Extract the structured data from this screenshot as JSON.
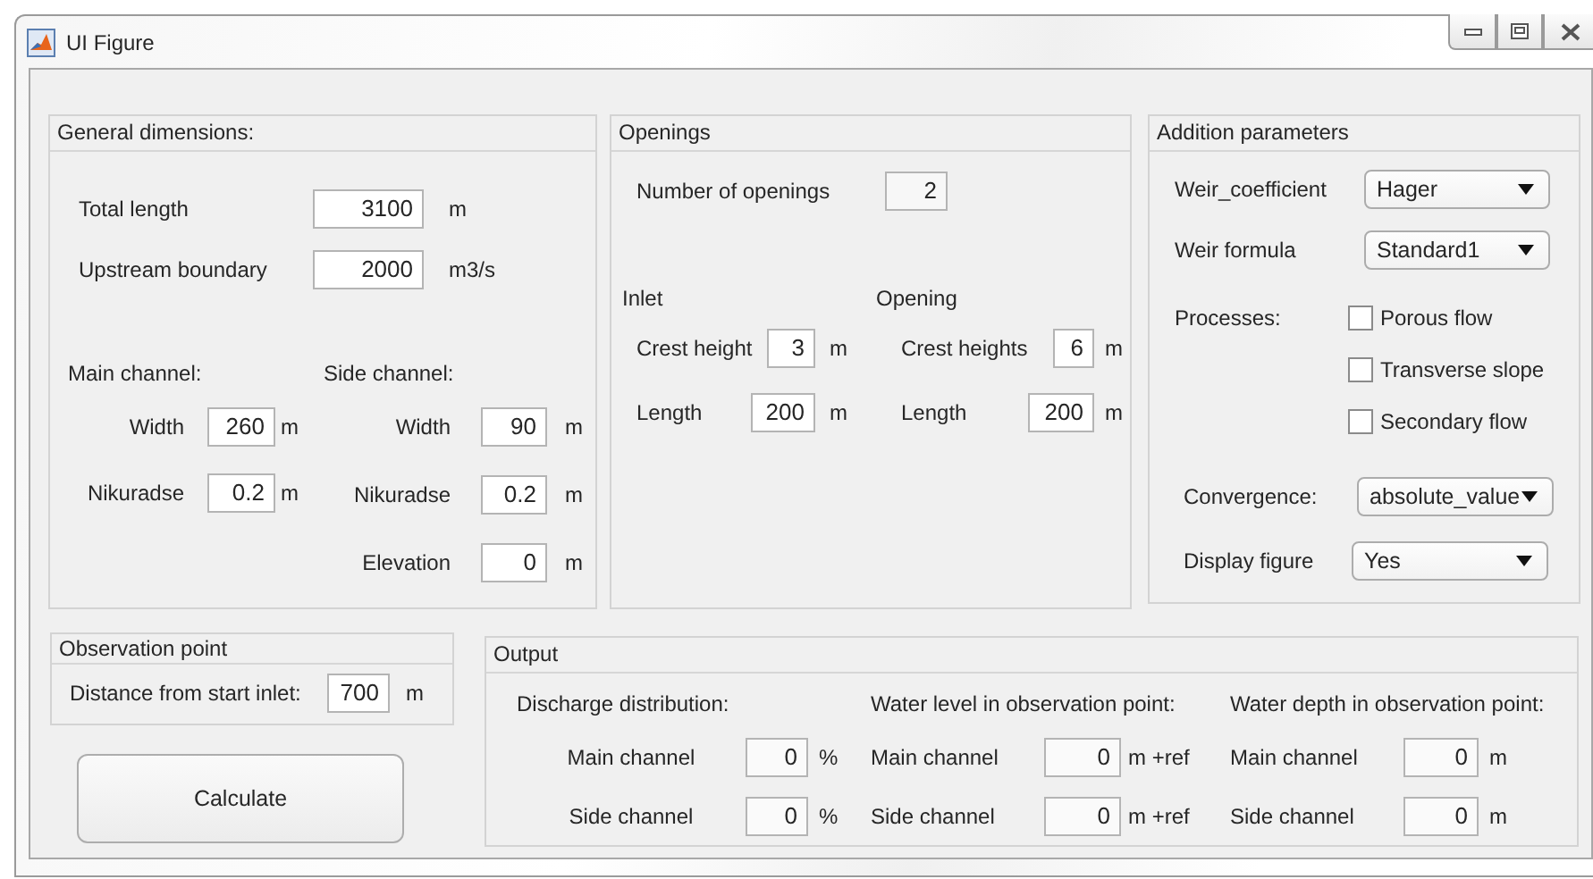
{
  "window": {
    "title": "UI Figure"
  },
  "general_dimensions": {
    "title": "General dimensions:",
    "fields": [
      {
        "label": "Total length",
        "value": "3100",
        "unit": "m"
      },
      {
        "label": "Upstream boundary",
        "value": "2000",
        "unit": "m3/s"
      }
    ],
    "main_channel": {
      "title": "Main channel:",
      "fields": [
        {
          "label": "Width",
          "value": "260",
          "unit": "m"
        },
        {
          "label": "Nikuradse",
          "value": "0.2",
          "unit": "m"
        }
      ]
    },
    "side_channel": {
      "title": "Side channel:",
      "fields": [
        {
          "label": "Width",
          "value": "90",
          "unit": "m"
        },
        {
          "label": "Nikuradse",
          "value": "0.2",
          "unit": "m"
        },
        {
          "label": "Elevation",
          "value": "0",
          "unit": "m"
        }
      ]
    }
  },
  "openings": {
    "title": "Openings",
    "number": {
      "label": "Number of openings",
      "value": "2"
    },
    "inlet": {
      "title": "Inlet",
      "fields": [
        {
          "label": "Crest height",
          "value": "3",
          "unit": "m"
        },
        {
          "label": "Length",
          "value": "200",
          "unit": "m"
        }
      ]
    },
    "opening": {
      "title": "Opening",
      "fields": [
        {
          "label": "Crest heights",
          "value": "6",
          "unit": "m"
        },
        {
          "label": "Length",
          "value": "200",
          "unit": "m"
        }
      ]
    }
  },
  "addition_parameters": {
    "title": "Addition parameters",
    "dropdowns": [
      {
        "label": "Weir_coefficient",
        "value": "Hager"
      },
      {
        "label": "Weir formula",
        "value": "Standard1"
      }
    ],
    "processes": {
      "label": "Processes:",
      "options": [
        {
          "label": "Porous flow",
          "checked": false
        },
        {
          "label": "Transverse slope",
          "checked": false
        },
        {
          "label": "Secondary flow",
          "checked": false
        }
      ]
    },
    "settings": [
      {
        "label": "Convergence:",
        "value": "absolute_value"
      },
      {
        "label": "Display figure",
        "value": "Yes"
      }
    ]
  },
  "observation_point": {
    "title": "Observation point",
    "field": {
      "label": "Distance from start inlet:",
      "value": "700",
      "unit": "m"
    }
  },
  "calculate_button": {
    "label": "Calculate"
  },
  "output": {
    "title": "Output",
    "groups": [
      {
        "title": "Discharge distribution:",
        "fields": [
          {
            "label": "Main channel",
            "value": "0",
            "unit": "%"
          },
          {
            "label": "Side channel",
            "value": "0",
            "unit": "%"
          }
        ]
      },
      {
        "title": "Water level in observation point:",
        "fields": [
          {
            "label": "Main channel",
            "value": "0",
            "unit": "m +ref"
          },
          {
            "label": "Side channel",
            "value": "0",
            "unit": "m +ref"
          }
        ]
      },
      {
        "title": "Water depth in observation point:",
        "fields": [
          {
            "label": "Main channel",
            "value": "0",
            "unit": "m"
          },
          {
            "label": "Side channel",
            "value": "0",
            "unit": "m"
          }
        ]
      }
    ]
  }
}
